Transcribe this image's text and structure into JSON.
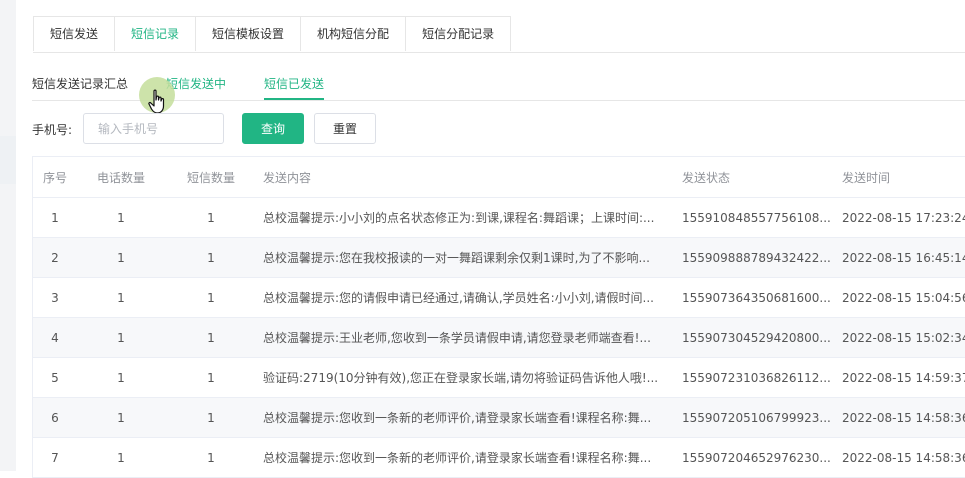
{
  "top_tabs": [
    {
      "label": "短信发送",
      "active": false
    },
    {
      "label": "短信记录",
      "active": true
    },
    {
      "label": "短信模板设置",
      "active": false
    },
    {
      "label": "机构短信分配",
      "active": false
    },
    {
      "label": "短信分配记录",
      "active": false
    }
  ],
  "sub_tabs": [
    {
      "label": "短信发送记录汇总",
      "active": false
    },
    {
      "label": "短信发送中",
      "active": false
    },
    {
      "label": "短信已发送",
      "active": true
    }
  ],
  "search": {
    "label": "手机号:",
    "placeholder": "输入手机号",
    "value": "",
    "query_button": "查询",
    "reset_button": "重置"
  },
  "colors": {
    "accent": "#21b584",
    "row_stripe": "#f7f8fa",
    "border": "#ebeef5"
  },
  "table": {
    "columns": [
      "序号",
      "电话数量",
      "短信数量",
      "发送内容",
      "发送状态",
      "发送时间"
    ],
    "rows": [
      [
        "1",
        "1",
        "1",
        "总校温馨提示:小小刘的点名状态修正为:到课,课程名:舞蹈课；上课时间:...",
        "155910848557756108...",
        "2022-08-15 17:23:24"
      ],
      [
        "2",
        "1",
        "1",
        "总校温馨提示:您在我校报读的一对一舞蹈课剩余仅剩1课时,为了不影响...",
        "155909888789432422...",
        "2022-08-15 16:45:14"
      ],
      [
        "3",
        "1",
        "1",
        "总校温馨提示:您的请假申请已经通过,请确认,学员姓名:小小刘,请假时间...",
        "155907364350681600...",
        "2022-08-15 15:04:56"
      ],
      [
        "4",
        "1",
        "1",
        "总校温馨提示:王业老师,您收到一条学员请假申请,请您登录老师端查看!...",
        "155907304529420800...",
        "2022-08-15 15:02:34"
      ],
      [
        "5",
        "1",
        "1",
        "验证码:2719(10分钟有效),您正在登录家长端,请勿将验证码告诉他人哦!...",
        "155907231036826112...",
        "2022-08-15 14:59:37"
      ],
      [
        "6",
        "1",
        "1",
        "总校温馨提示:您收到一条新的老师评价,请登录家长端查看!课程名称:舞...",
        "155907205106799923...",
        "2022-08-15 14:58:36"
      ],
      [
        "7",
        "1",
        "1",
        "总校温馨提示:您收到一条新的老师评价,请登录家长端查看!课程名称:舞...",
        "155907204652976230...",
        "2022-08-15 14:58:36"
      ]
    ]
  }
}
